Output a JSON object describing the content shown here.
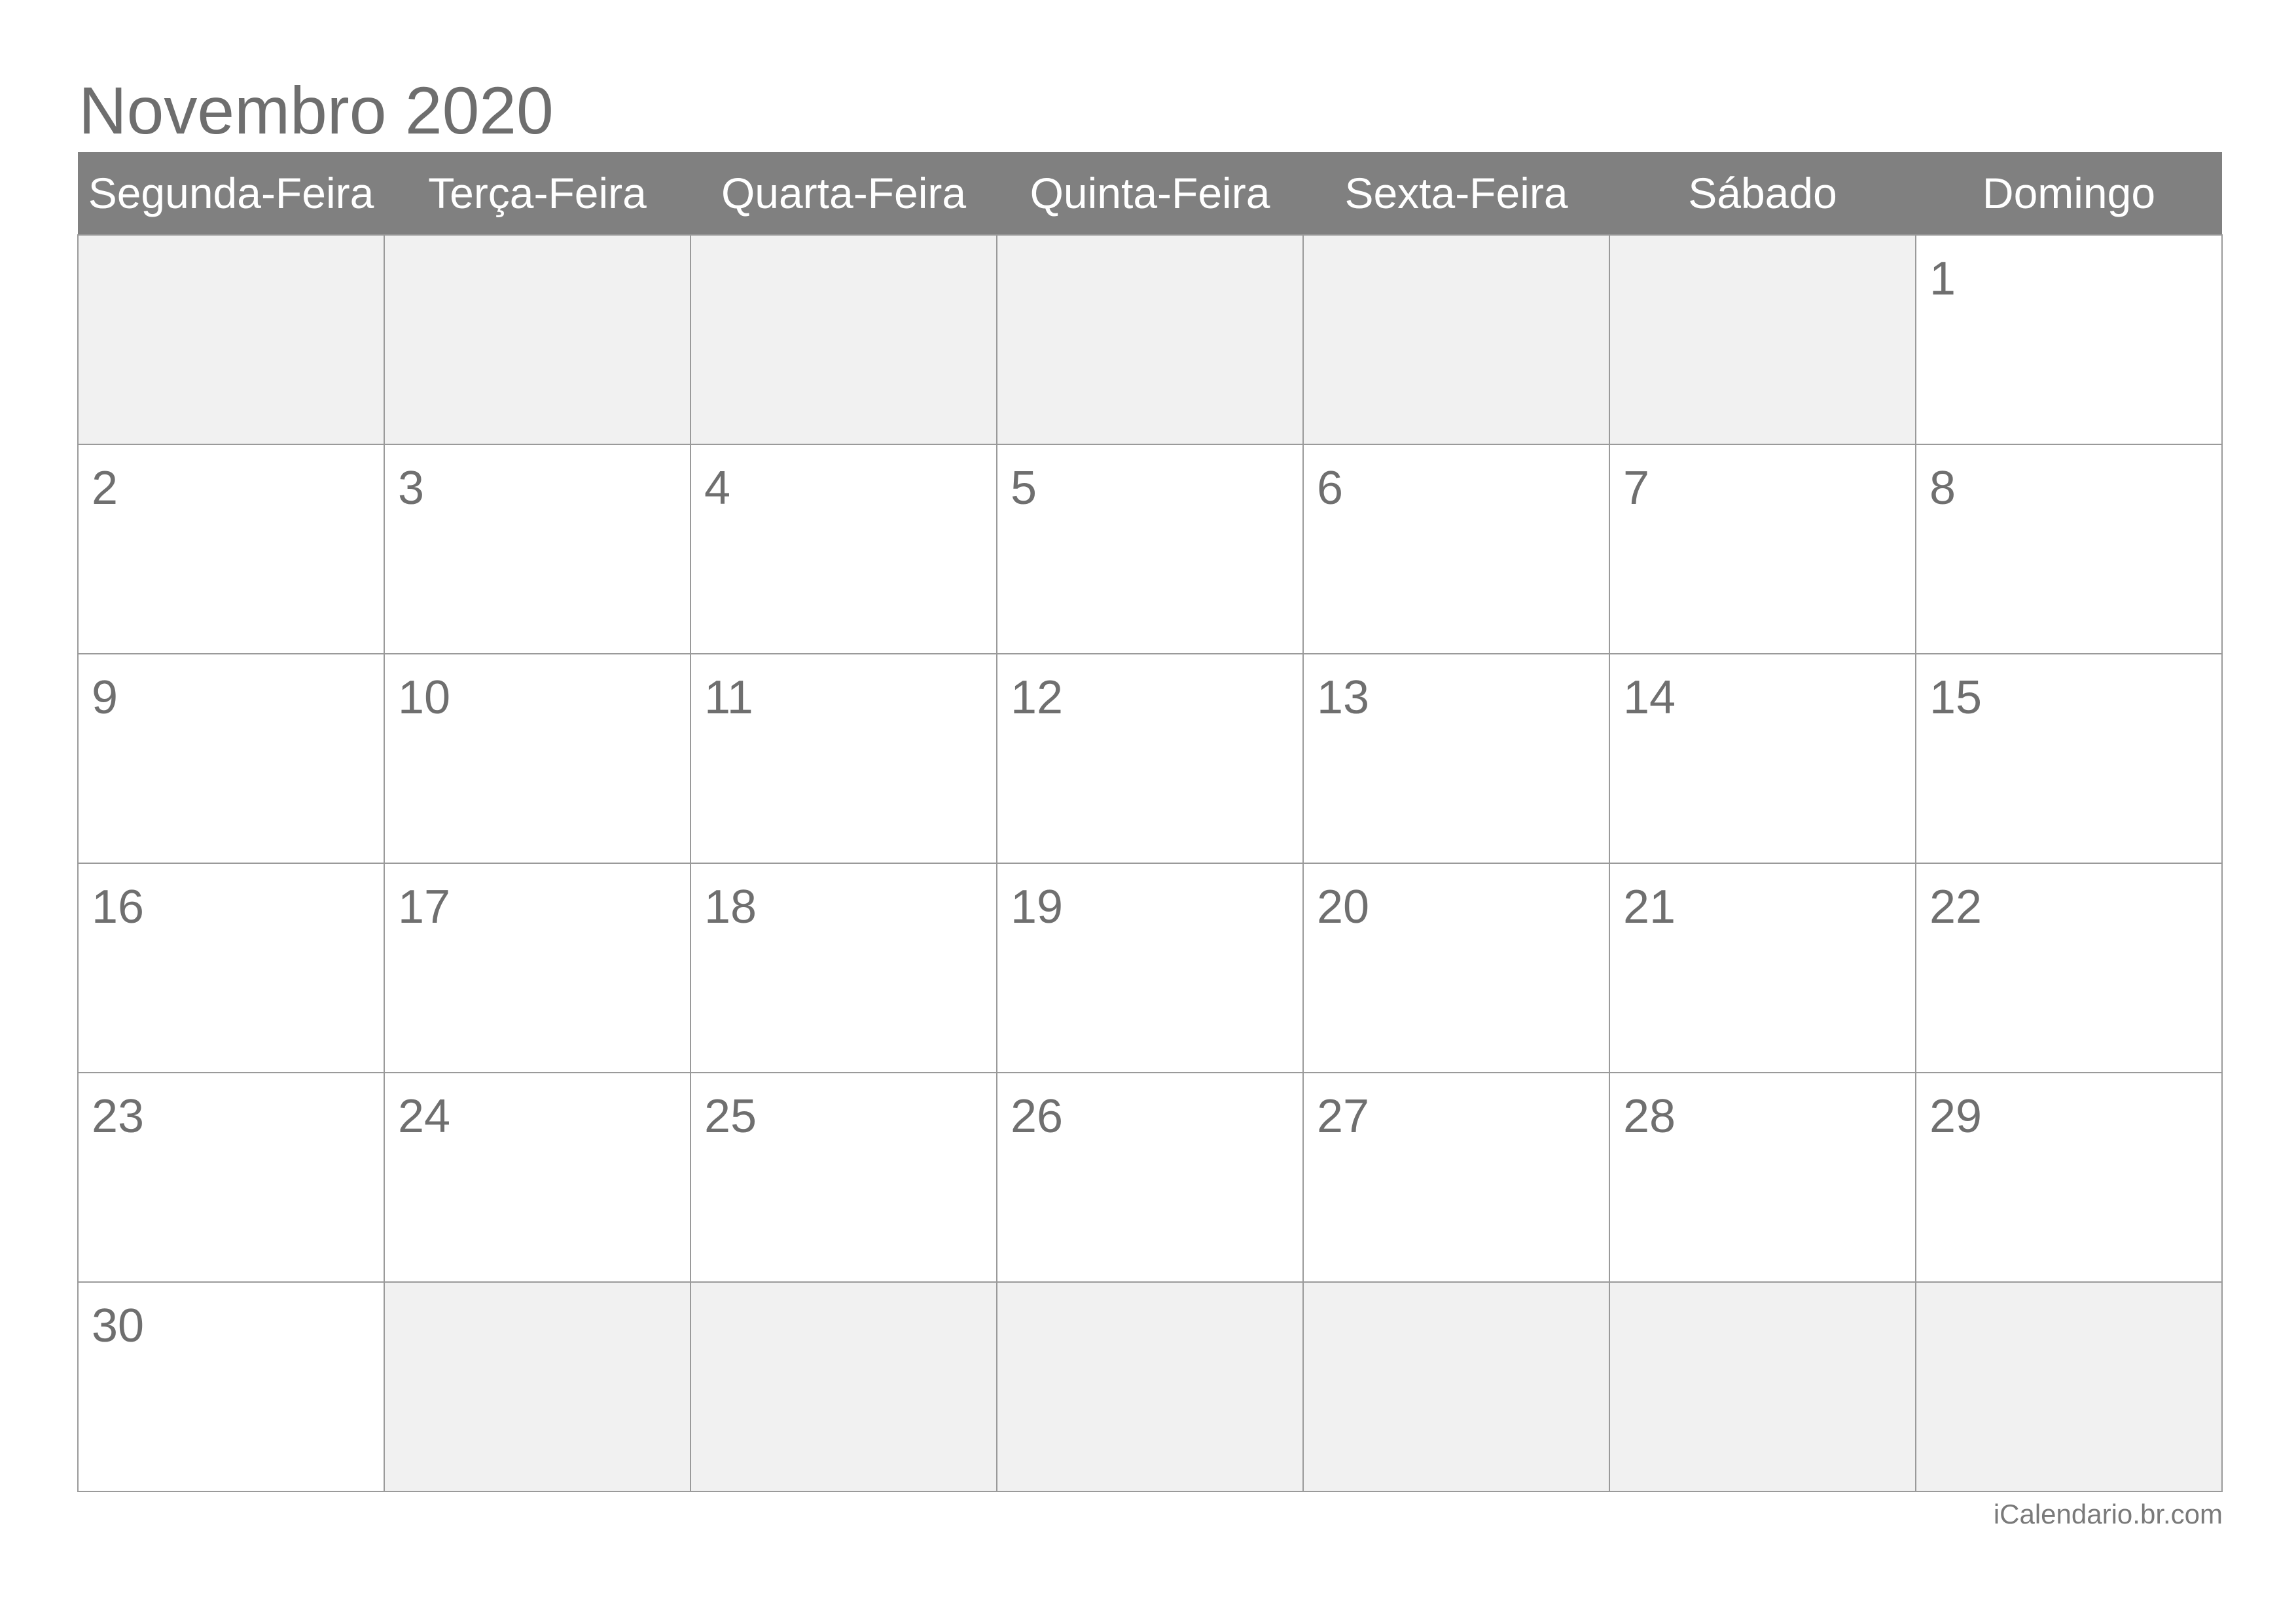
{
  "title": "Novembro 2020",
  "weekdays": [
    "Segunda-Feira",
    "Terça-Feira",
    "Quarta-Feira",
    "Quinta-Feira",
    "Sexta-Feira",
    "Sábado",
    "Domingo"
  ],
  "weeks": [
    [
      "",
      "",
      "",
      "",
      "",
      "",
      "1"
    ],
    [
      "2",
      "3",
      "4",
      "5",
      "6",
      "7",
      "8"
    ],
    [
      "9",
      "10",
      "11",
      "12",
      "13",
      "14",
      "15"
    ],
    [
      "16",
      "17",
      "18",
      "19",
      "20",
      "21",
      "22"
    ],
    [
      "23",
      "24",
      "25",
      "26",
      "27",
      "28",
      "29"
    ],
    [
      "30",
      "",
      "",
      "",
      "",
      "",
      ""
    ]
  ],
  "footer": "iCalendario.br.com",
  "colors": {
    "header_bg": "#808080",
    "empty_cell_bg": "#f1f1f1",
    "grid_line": "#9a9a9a",
    "text": "#6e6e6e"
  }
}
